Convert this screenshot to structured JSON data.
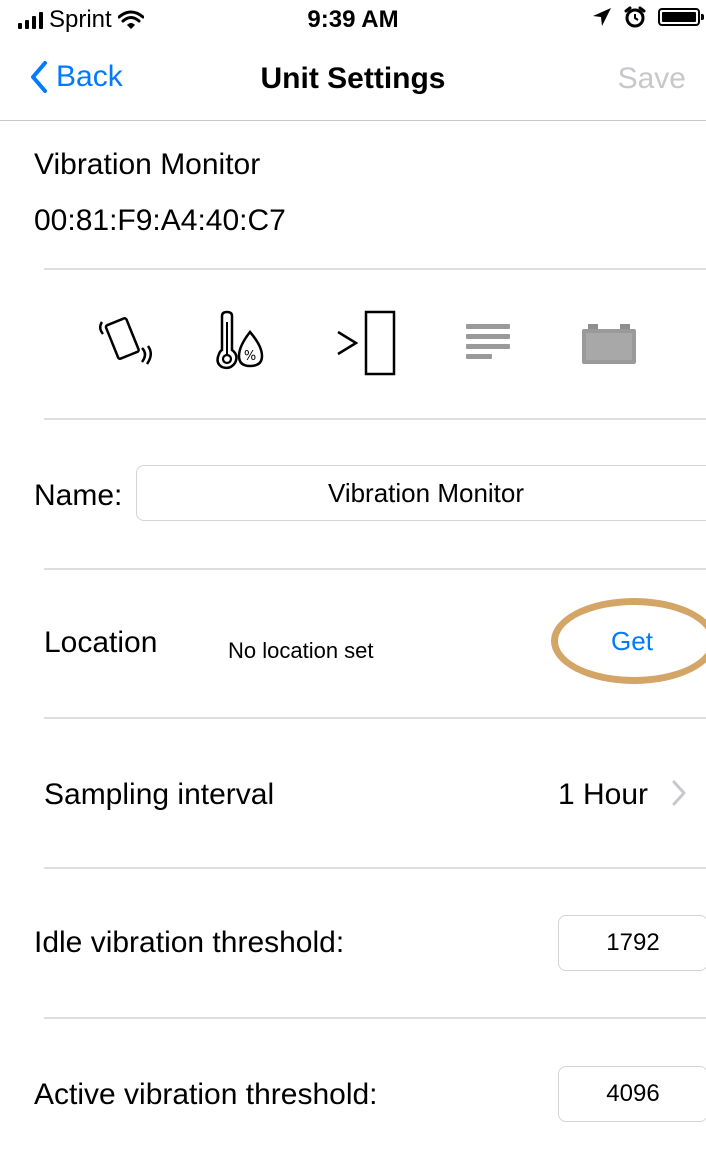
{
  "status_bar": {
    "carrier": "Sprint",
    "time": "9:39 AM"
  },
  "nav": {
    "back_label": "Back",
    "title": "Unit Settings",
    "save_label": "Save"
  },
  "device": {
    "name": "Vibration Monitor",
    "mac": "00:81:F9:A4:40:C7"
  },
  "sensor_icons": [
    "vibration-icon",
    "temperature-humidity-icon",
    "proximity-icon",
    "log-icon",
    "battery-icon"
  ],
  "form": {
    "name_label": "Name:",
    "name_value": "Vibration Monitor",
    "location_label": "Location",
    "location_value": "No location set",
    "location_button": "Get",
    "interval_label": "Sampling interval",
    "interval_value": "1 Hour",
    "idle_label": "Idle vibration threshold:",
    "idle_value": "1792",
    "active_label": "Active vibration threshold:",
    "active_value": "4096"
  },
  "colors": {
    "accent": "#007aff",
    "disabled": "#c7c7cc",
    "highlight": "#d3a567",
    "divider": "#dedede"
  }
}
